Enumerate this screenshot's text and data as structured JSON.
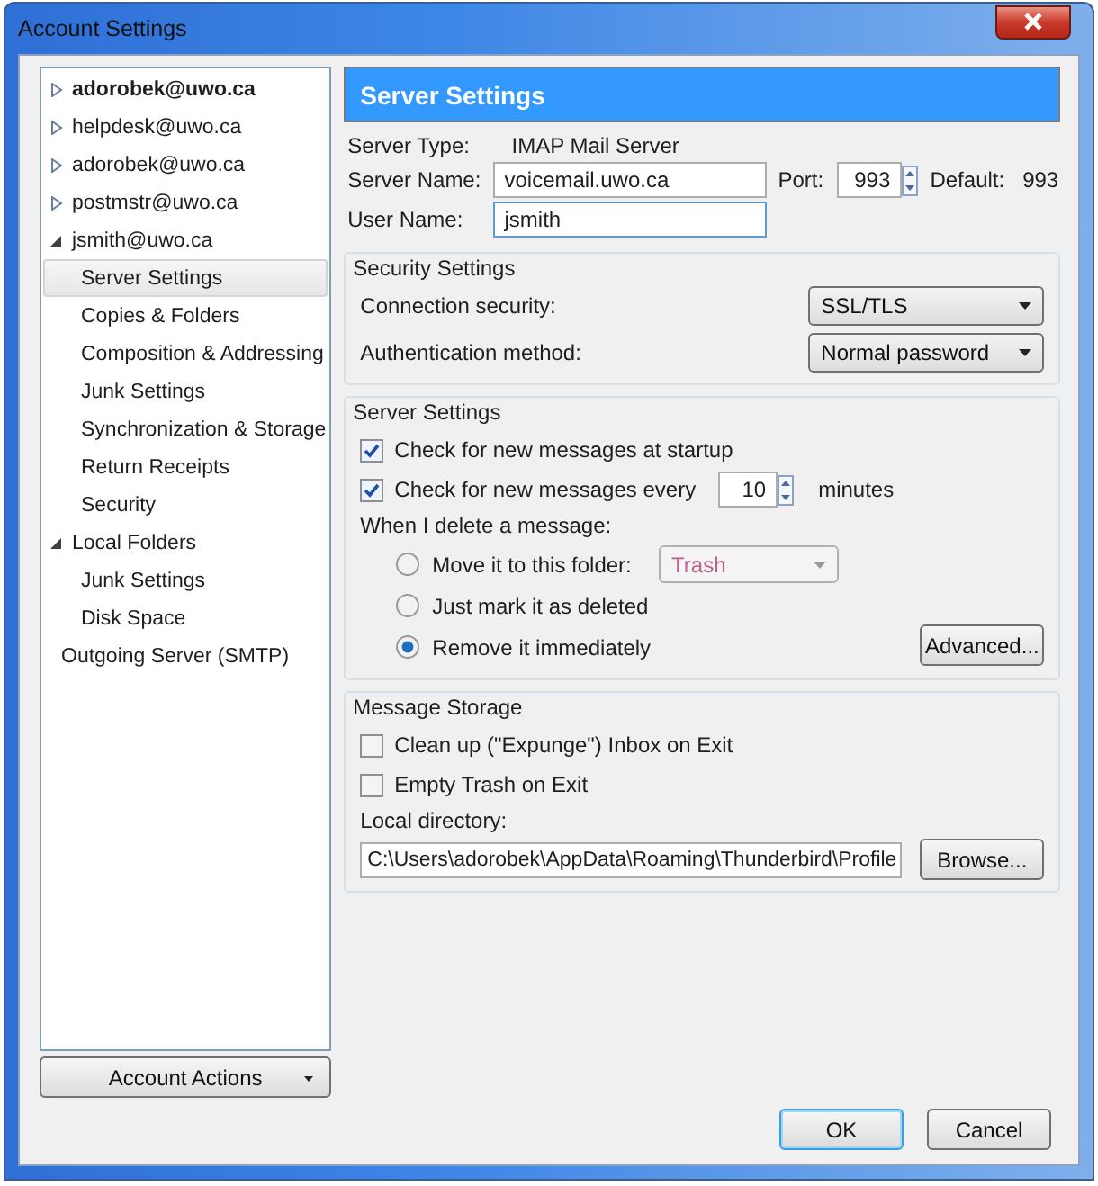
{
  "window": {
    "title": "Account Settings"
  },
  "tree": [
    {
      "label": "adorobek@uwo.ca",
      "default": true,
      "expanded": false,
      "selected": false
    },
    {
      "label": "helpdesk@uwo.ca",
      "default": false,
      "expanded": false,
      "selected": false
    },
    {
      "label": "adorobek@uwo.ca",
      "default": false,
      "expanded": false,
      "selected": false
    },
    {
      "label": "postmstr@uwo.ca",
      "default": false,
      "expanded": false,
      "selected": false
    },
    {
      "label": "jsmith@uwo.ca",
      "default": false,
      "expanded": true,
      "selected": false,
      "children": [
        {
          "label": "Server Settings",
          "selected": true
        },
        {
          "label": "Copies & Folders",
          "selected": false
        },
        {
          "label": "Composition & Addressing",
          "selected": false
        },
        {
          "label": "Junk Settings",
          "selected": false
        },
        {
          "label": "Synchronization & Storage",
          "selected": false
        },
        {
          "label": "Return Receipts",
          "selected": false
        },
        {
          "label": "Security",
          "selected": false
        }
      ]
    },
    {
      "label": "Local Folders",
      "default": false,
      "expanded": true,
      "selected": false,
      "children": [
        {
          "label": "Junk Settings",
          "selected": false
        },
        {
          "label": "Disk Space",
          "selected": false
        }
      ]
    },
    {
      "label": "Outgoing Server (SMTP)",
      "default": false,
      "selected": false
    }
  ],
  "account_actions": "Account Actions",
  "panel": {
    "header": "Server Settings",
    "server_type": {
      "label": "Server Type:",
      "value": "IMAP Mail Server"
    },
    "server_name": {
      "label": "Server Name:",
      "value": "voicemail.uwo.ca"
    },
    "port": {
      "label": "Port:",
      "value": "993"
    },
    "default_port": {
      "label": "Default:",
      "value": "993"
    },
    "user_name": {
      "label": "User Name:",
      "value": "jsmith"
    }
  },
  "security": {
    "title": "Security Settings",
    "rows": [
      {
        "label": "Connection security:",
        "value": "SSL/TLS"
      },
      {
        "label": "Authentication method:",
        "value": "Normal password"
      }
    ]
  },
  "server_settings": {
    "title": "Server Settings",
    "options": [
      {
        "kind": "checkbox",
        "label": "Check for new messages at startup",
        "checked": true
      },
      {
        "kind": "interval",
        "label": "Check for new messages every",
        "checked": true,
        "value": "10",
        "unit": "minutes"
      }
    ],
    "delete_label": "When I delete a message:",
    "delete_options": [
      {
        "label": "Move it to this folder:",
        "selected": false,
        "folder": "Trash"
      },
      {
        "label": "Just mark it as deleted",
        "selected": false
      },
      {
        "label": "Remove it immediately",
        "selected": true
      }
    ],
    "advanced": "Advanced..."
  },
  "storage": {
    "title": "Message Storage",
    "options": [
      {
        "label": "Clean up (\"Expunge\") Inbox on Exit",
        "checked": false
      },
      {
        "label": "Empty Trash on Exit",
        "checked": false
      }
    ],
    "directory_label": "Local directory:",
    "directory": "C:\\Users\\adorobek\\AppData\\Roaming\\Thunderbird\\Profile",
    "browse": "Browse..."
  },
  "buttons": [
    {
      "label": "OK",
      "default": true
    },
    {
      "label": "Cancel",
      "default": false
    }
  ]
}
